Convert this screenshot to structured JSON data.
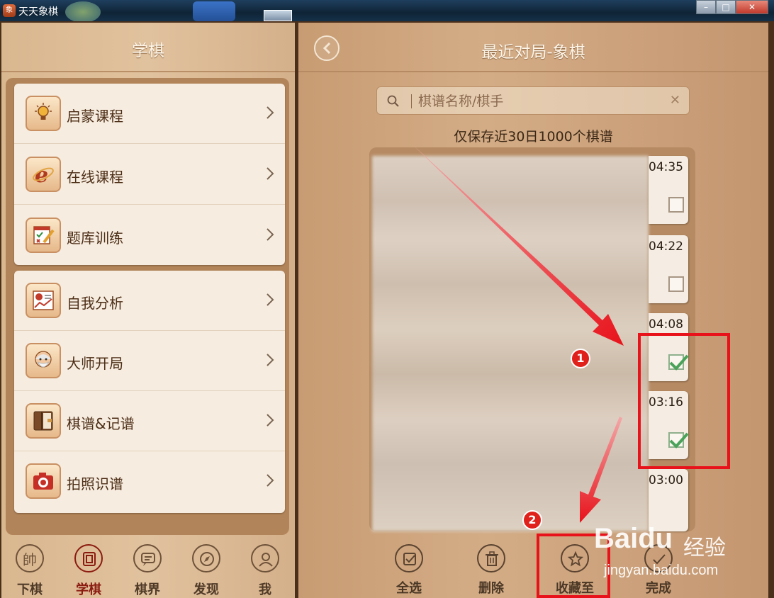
{
  "window": {
    "app_icon_text": "象",
    "title": "天天象棋"
  },
  "left_panel": {
    "title": "学棋",
    "menu_group1": [
      {
        "label": "启蒙课程",
        "icon": "lightbulb-icon"
      },
      {
        "label": "在线课程",
        "icon": "ie-browser-icon"
      },
      {
        "label": "题库训练",
        "icon": "exam-pencil-icon"
      }
    ],
    "menu_group2": [
      {
        "label": "自我分析",
        "icon": "analysis-chart-icon"
      },
      {
        "label": "大师开局",
        "icon": "master-avatar-icon"
      },
      {
        "label": "棋谱&记谱",
        "icon": "notebook-icon"
      },
      {
        "label": "拍照识谱",
        "icon": "camera-icon"
      }
    ],
    "bottom_nav": [
      {
        "label": "下棋",
        "glyph": "帥",
        "active": false
      },
      {
        "label": "学棋",
        "glyph": "",
        "active": true
      },
      {
        "label": "棋界",
        "glyph": "",
        "active": false
      },
      {
        "label": "发现",
        "glyph": "",
        "active": false
      },
      {
        "label": "我",
        "glyph": "",
        "active": false
      }
    ]
  },
  "right_panel": {
    "title": "最近对局-象棋",
    "search": {
      "placeholder": "棋谱名称/棋手",
      "value": ""
    },
    "note": "仅保存近30日1000个棋谱",
    "games": [
      {
        "time": "04:35",
        "checked": false
      },
      {
        "time": "04:22",
        "checked": false
      },
      {
        "time": "04:08",
        "checked": true
      },
      {
        "time": "03:16",
        "checked": true
      },
      {
        "time": "03:00",
        "checked": false
      }
    ],
    "bottom_actions": [
      {
        "label": "全选",
        "icon": "select-all-icon"
      },
      {
        "label": "删除",
        "icon": "trash-icon"
      },
      {
        "label": "收藏至",
        "icon": "star-icon"
      },
      {
        "label": "完成",
        "icon": "done-icon"
      }
    ]
  },
  "annotations": {
    "step1": "1",
    "step2": "2"
  },
  "watermark": {
    "logo": "Baidu",
    "cn": "经验",
    "url": "jingyan.baidu.com"
  },
  "colors": {
    "accent_red": "#e8121b",
    "active_nav": "#8b1b10",
    "check_green": "#4aa35a"
  }
}
